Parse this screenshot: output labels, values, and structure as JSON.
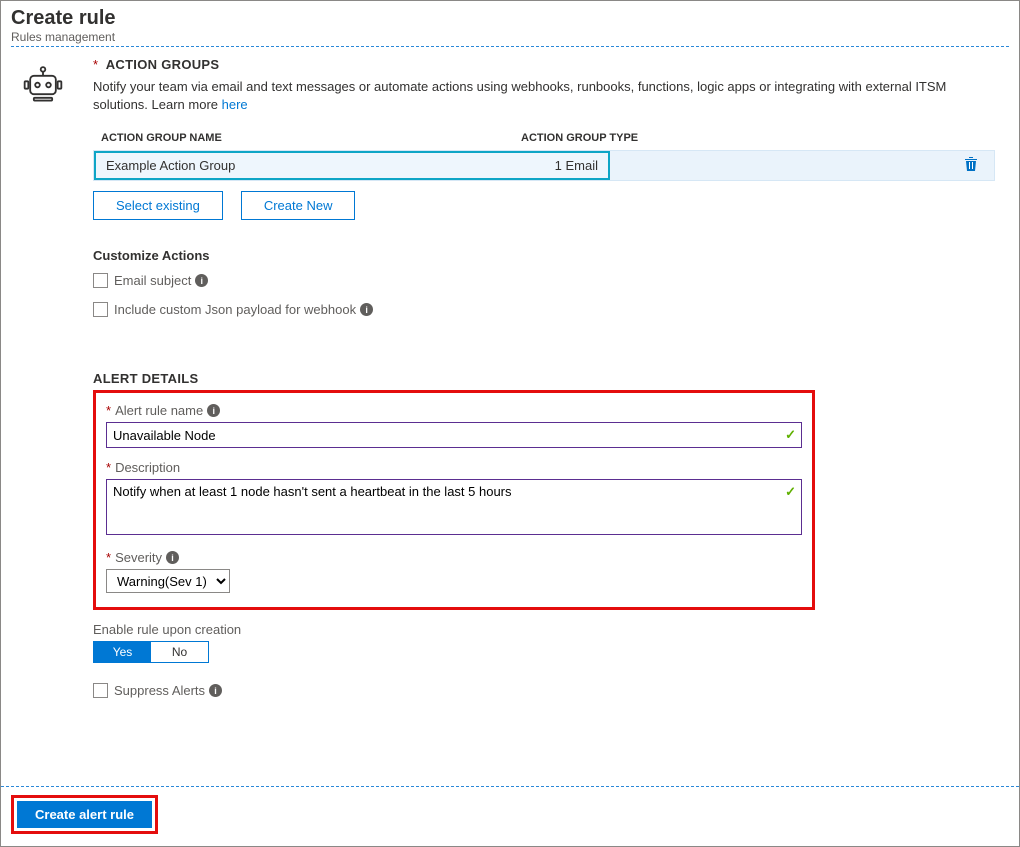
{
  "header": {
    "title": "Create rule",
    "subtitle": "Rules management"
  },
  "actionGroups": {
    "title": "ACTION GROUPS",
    "desc_prefix": "Notify your team via email and text messages or automate actions using webhooks, runbooks, functions, logic apps or integrating with external ITSM solutions. Learn more ",
    "learn_more": "here",
    "col_name": "ACTION GROUP NAME",
    "col_type": "ACTION GROUP TYPE",
    "row_name": "Example Action Group",
    "row_type": "1 Email",
    "select_existing": "Select existing",
    "create_new": "Create New"
  },
  "customize": {
    "heading": "Customize Actions",
    "email_subject": "Email subject",
    "json_payload": "Include custom Json payload for webhook"
  },
  "details": {
    "heading": "ALERT DETAILS",
    "name_label": "Alert rule name",
    "name_value": "Unavailable Node",
    "desc_label": "Description",
    "desc_value": "Notify when at least 1 node hasn't sent a heartbeat in the last 5 hours",
    "severity_label": "Severity",
    "severity_value": "Warning(Sev 1)",
    "enable_label": "Enable rule upon creation",
    "yes": "Yes",
    "no": "No",
    "suppress": "Suppress Alerts"
  },
  "footer": {
    "create": "Create alert rule"
  }
}
